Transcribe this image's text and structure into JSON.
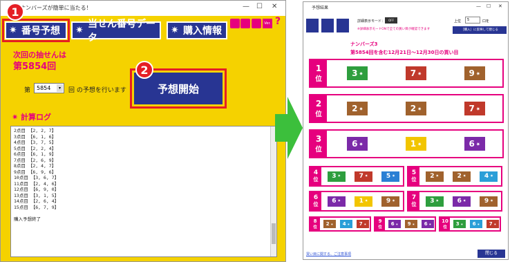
{
  "left": {
    "title": "ナンバーズが簡単に当たる！",
    "nav": [
      "番号予想",
      "当せん番号データ",
      "購入情報"
    ],
    "ver": "Ver.",
    "help": "?",
    "next_label": "次回の抽せんは",
    "next_draw": "第5854回",
    "round_prefix": "第",
    "round_value": "5854",
    "round_suffix": "回 の予想を行います",
    "start_button": "予想開始",
    "log_title": "計算ログ",
    "log_lines": [
      "2点目 【2, 2, 7】",
      "3点目 【6, 1, 6】",
      "4点目 【3, 7, 5】",
      "5点目 【2, 2, 4】",
      "6点目 【6, 1, 9】",
      "7点目 【2, 6, 9】",
      "8点目 【2, 4, 7】",
      "9点目 【6, 9, 6】",
      "10点目 【3, 6, 7】",
      "11点目 【2, 4, 6】",
      "12点目 【6, 9, 0】",
      "13点目 【3, 1, 5】",
      "14点目 【2, 6, 4】",
      "15点目 【6, 7, 9】",
      "",
      "購入予想終了"
    ],
    "badge1": "1",
    "badge2": "2"
  },
  "right": {
    "title": "予想結果",
    "detail_label": "詳細表示モード：",
    "toggle": "OFF",
    "hint": "※詳細表示モードONで全ての買い目が確認できます",
    "top_label": "上位",
    "top_value": "5",
    "top_unit": "口を",
    "apply_button": "［購入］に反映して閉じる",
    "game": "ナンバーズ3",
    "period": "第5854回を含む12月21日～12月30日の買い目",
    "rank_suffix": "位",
    "footer_link": "買い目に関する、ご注意事項",
    "close_button": "閉じる",
    "big": [
      {
        "rank": "1",
        "nums": [
          "3",
          "7",
          "9"
        ],
        "colors": [
          "#2e9e3e",
          "#c0392b",
          "#a0622d"
        ]
      },
      {
        "rank": "2",
        "nums": [
          "2",
          "2",
          "7"
        ],
        "colors": [
          "#a0622d",
          "#a0622d",
          "#c0392b"
        ]
      },
      {
        "rank": "3",
        "nums": [
          "6",
          "1",
          "6"
        ],
        "colors": [
          "#7b2aa8",
          "#f2c500",
          "#7b2aa8"
        ]
      }
    ],
    "mid": [
      {
        "rank": "4",
        "nums": [
          "3",
          "7",
          "5"
        ],
        "colors": [
          "#2e9e3e",
          "#c0392b",
          "#2a7fd4"
        ]
      },
      {
        "rank": "5",
        "nums": [
          "2",
          "2",
          "4"
        ],
        "colors": [
          "#a0622d",
          "#a0622d",
          "#2a9fd8"
        ]
      },
      {
        "rank": "6",
        "nums": [
          "6",
          "1",
          "9"
        ],
        "colors": [
          "#7b2aa8",
          "#f2c500",
          "#a0622d"
        ]
      },
      {
        "rank": "7",
        "nums": [
          "3",
          "6",
          "9"
        ],
        "colors": [
          "#2e9e3e",
          "#7b2aa8",
          "#a0622d"
        ]
      }
    ],
    "small": [
      {
        "rank": "8",
        "nums": [
          "2",
          "4",
          "7"
        ],
        "colors": [
          "#a0622d",
          "#2a9fd8",
          "#c0392b"
        ]
      },
      {
        "rank": "9",
        "nums": [
          "6",
          "9",
          "6"
        ],
        "colors": [
          "#7b2aa8",
          "#a0622d",
          "#7b2aa8"
        ]
      },
      {
        "rank": "10",
        "nums": [
          "3",
          "6",
          "7"
        ],
        "colors": [
          "#2e9e3e",
          "#2a9fd8",
          "#c0392b"
        ]
      }
    ]
  }
}
